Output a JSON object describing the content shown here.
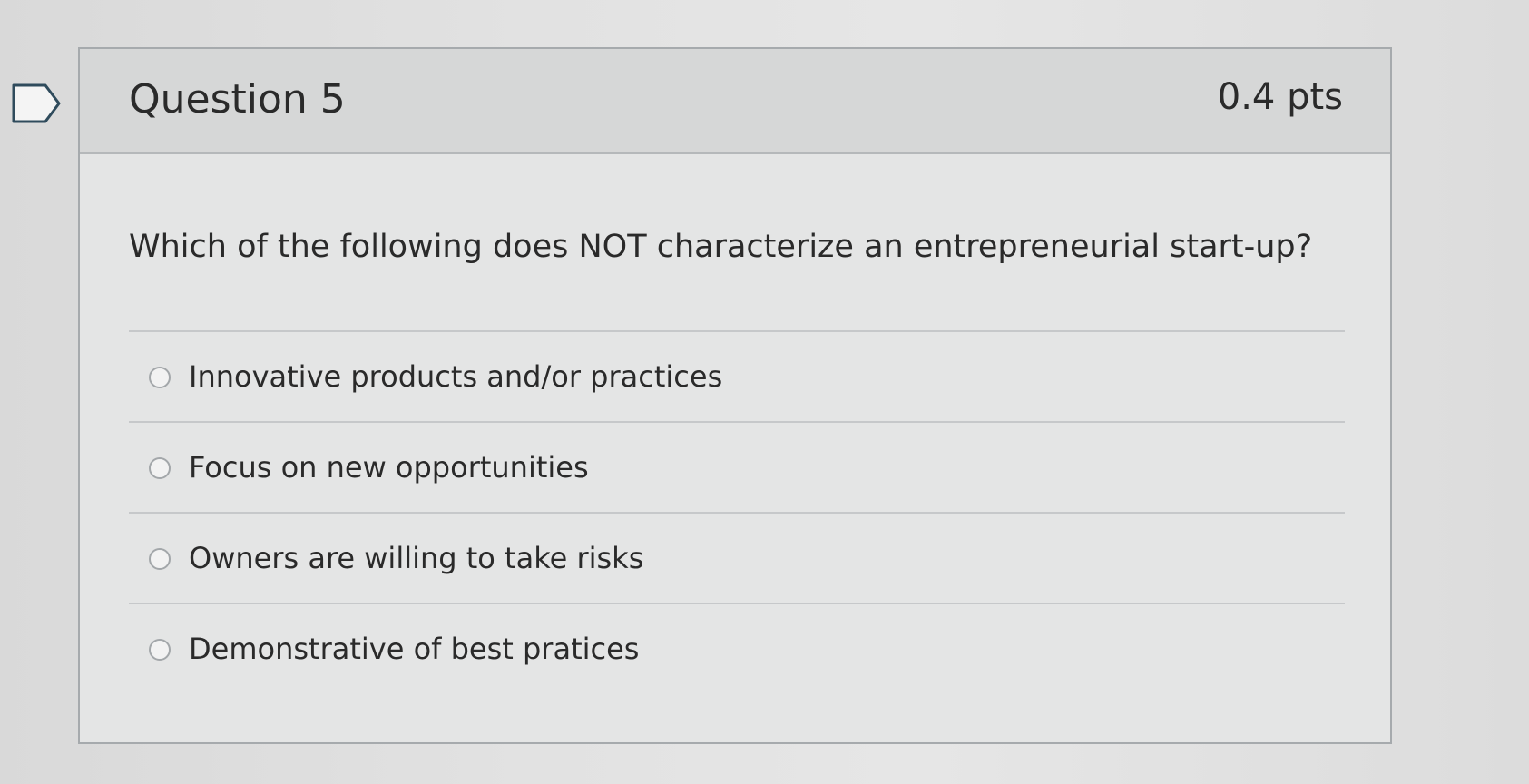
{
  "question": {
    "title": "Question 5",
    "points": "0.4 pts",
    "text": "Which of the following does NOT characterize an entrepreneurial start-up?",
    "flag_icon": "bookmark-flag-icon"
  },
  "answers": [
    {
      "label": "Innovative products and/or practices",
      "selected": false
    },
    {
      "label": "Focus on new opportunities",
      "selected": false
    },
    {
      "label": "Owners are willing to take risks",
      "selected": false
    },
    {
      "label": "Demonstrative of best pratices",
      "selected": false
    }
  ],
  "colors": {
    "header_bg": "#d6d7d7",
    "card_bg": "#e4e5e5",
    "border": "#a6aaad",
    "text": "#2a2a2a"
  }
}
